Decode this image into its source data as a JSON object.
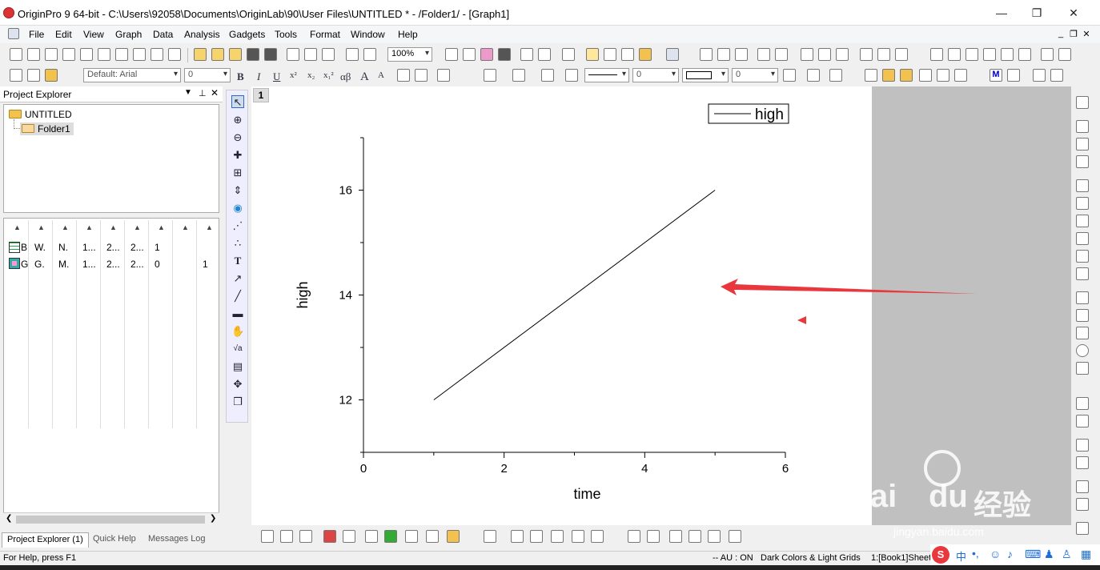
{
  "window": {
    "title": "OriginPro 9 64-bit - C:\\Users\\92058\\Documents\\OriginLab\\90\\User Files\\UNTITLED * - /Folder1/ - [Graph1]"
  },
  "menu": [
    "File",
    "Edit",
    "View",
    "Graph",
    "Data",
    "Analysis",
    "Gadgets",
    "Tools",
    "Format",
    "Window",
    "Help"
  ],
  "toolbar": {
    "zoom": "100%",
    "font": "Default: Arial",
    "font_size": "0",
    "line_width": "0",
    "pattern_value": "0"
  },
  "format_buttons": [
    "B",
    "I",
    "U",
    "x²",
    "x₂",
    "x₁²",
    "αβ",
    "A",
    "A"
  ],
  "project_explorer": {
    "title": "Project Explorer",
    "root": "UNTITLED",
    "folder": "Folder1",
    "rows": [
      {
        "icon": "workbook-icon",
        "cells": [
          "B",
          "W.",
          "N.",
          "1...",
          "2...",
          "2...",
          "1",
          ""
        ]
      },
      {
        "icon": "graph-icon",
        "cells": [
          "G",
          "G.",
          "M.",
          "1...",
          "2...",
          "2...",
          "0",
          "1"
        ]
      }
    ]
  },
  "panel_tabs": [
    "Project Explorer (1)",
    "Quick Help",
    "Messages Log"
  ],
  "graph": {
    "layer": "1"
  },
  "chart_data": {
    "type": "line",
    "series": [
      {
        "name": "high",
        "x": [
          1,
          5
        ],
        "y": [
          12,
          16
        ]
      }
    ],
    "xlabel": "time",
    "ylabel": "high",
    "xlim": [
      0,
      6
    ],
    "ylim": [
      11,
      17
    ],
    "xticks": [
      "0",
      "2",
      "4",
      "6"
    ],
    "yticks": [
      "12",
      "14",
      "16"
    ],
    "legend": "top-right",
    "grid": false
  },
  "annotation": {
    "arrow_color": "#e8383d"
  },
  "status": {
    "help": "For Help, press F1",
    "au": "-- AU : ON",
    "theme": "Dark Colors & Light Grids",
    "sheet": "1:[Book1]Sheet"
  },
  "watermark": {
    "brand": "Bai",
    "brand2": "du",
    "cn": "经验",
    "url": "jingyan.baidu.com"
  }
}
